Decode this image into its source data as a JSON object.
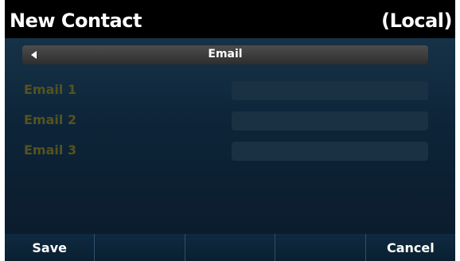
{
  "header": {
    "title": "New Contact",
    "location": "(Local)"
  },
  "section": {
    "label": "Email",
    "nav_icon": "left-triangle-icon"
  },
  "fields": [
    {
      "label": "Email 1",
      "value": ""
    },
    {
      "label": "Email 2",
      "value": ""
    },
    {
      "label": "Email 3",
      "value": ""
    }
  ],
  "softkeys": [
    {
      "label": "Save"
    },
    {
      "label": ""
    },
    {
      "label": ""
    },
    {
      "label": ""
    },
    {
      "label": "Cancel"
    }
  ],
  "colors": {
    "label_text": "#55531e",
    "background": "#0d2438",
    "softkey_background": "#0f2a40"
  }
}
